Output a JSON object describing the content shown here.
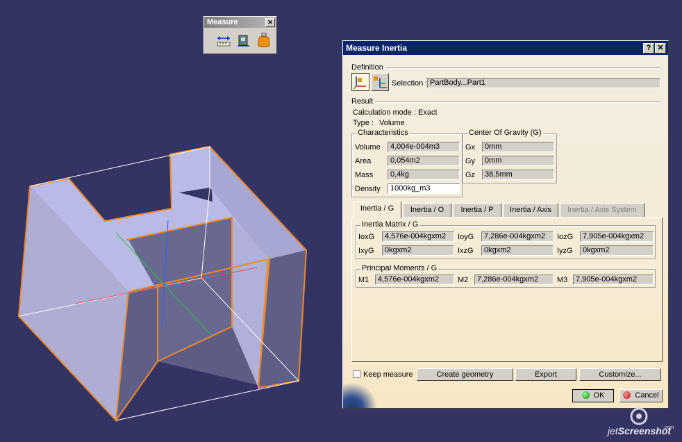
{
  "toolbar": {
    "title": "Measure",
    "close": "✕",
    "buttons": [
      "measure-between-icon",
      "measure-item-icon",
      "measure-inertia-icon"
    ]
  },
  "dialog": {
    "title": "Measure Inertia",
    "help": "?",
    "close": "✕",
    "definition_label": "Definition",
    "selection_label": "Selection :",
    "selection_value": "PartBody...Part1",
    "result_label": "Result",
    "calc_mode_label": "Calculation mode :",
    "calc_mode_value": "Exact",
    "type_label": "Type :",
    "type_value": "Volume",
    "characteristics": {
      "title": "Characteristics",
      "rows": [
        {
          "label": "Volume",
          "value": "4,004e-004m3"
        },
        {
          "label": "Area",
          "value": "0,054m2"
        },
        {
          "label": "Mass",
          "value": "0,4kg"
        },
        {
          "label": "Density",
          "value": "1000kg_m3"
        }
      ]
    },
    "cog": {
      "title": "Center Of Gravity (G)",
      "rows": [
        {
          "label": "Gx",
          "value": "0mm"
        },
        {
          "label": "Gy",
          "value": "0mm"
        },
        {
          "label": "Gz",
          "value": "38,5mm"
        }
      ]
    },
    "tabs": [
      "Inertia / G",
      "Inertia / O",
      "Inertia / P",
      "Inertia / Axis",
      "Inertia / Axis System"
    ],
    "matrix": {
      "title": "Inertia Matrix / G",
      "row1": [
        {
          "label": "IoxG",
          "value": "4,576e-004kgxm2"
        },
        {
          "label": "IoyG",
          "value": "7,286e-004kgxm2"
        },
        {
          "label": "IozG",
          "value": "7,905e-004kgxm2"
        }
      ],
      "row2": [
        {
          "label": "IxyG",
          "value": "0kgxm2"
        },
        {
          "label": "IxzG",
          "value": "0kgxm2"
        },
        {
          "label": "IyzG",
          "value": "0kgxm2"
        }
      ]
    },
    "principal": {
      "title": "Principal Moments / G",
      "row": [
        {
          "label": "M1",
          "value": "4,576e-004kgxm2"
        },
        {
          "label": "M2",
          "value": "7,286e-004kgxm2"
        },
        {
          "label": "M3",
          "value": "7,905e-004kgxm2"
        }
      ]
    },
    "keep_measure": "Keep measure",
    "create_geometry": "Create geometry",
    "export": "Export",
    "customize": "Customize...",
    "ok": "OK",
    "cancel": "Cancel"
  },
  "watermark": {
    "prefix": "jet",
    "name": "Screenshot",
    "suffix": ".com"
  },
  "colors": {
    "background": "#343464",
    "part_face": "#b9bae6",
    "part_edge": "#f08a24",
    "titlebar": "#0a246a"
  }
}
